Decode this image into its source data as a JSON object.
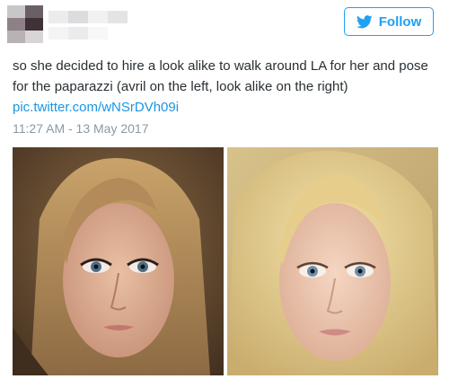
{
  "header": {
    "follow_label": "Follow",
    "icon": "twitter-bird-icon",
    "accent_color": "#1da1f2"
  },
  "tweet": {
    "text": "so she decided to hire a look alike to walk around LA for her and pose for the paparazzi (avril on the left, look alike on the right)",
    "link": "pic.twitter.com/wNSrDVh09i",
    "timestamp": "11:27 AM - 13 May 2017"
  },
  "media": {
    "photos": [
      "left-photo",
      "right-photo"
    ]
  }
}
